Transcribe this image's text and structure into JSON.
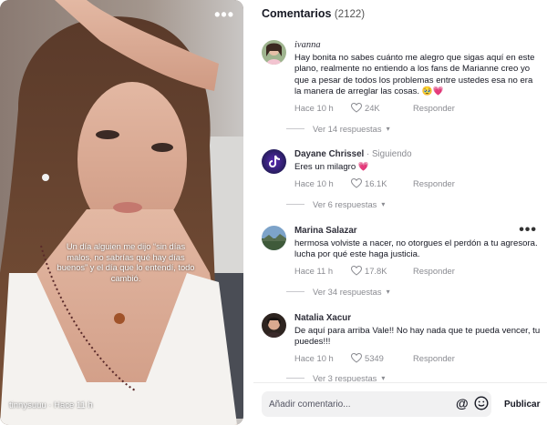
{
  "video": {
    "caption": "Un día alguien me dijo “sin días malos, no sabrías qué hay días buenos” y el día que lo entendí, todo cambió.",
    "author_time": "tinnysuuu · Hace 11 h",
    "more_icon": "more-horizontal-icon"
  },
  "comments_panel": {
    "title": "Comentarios",
    "count": "(2122)",
    "items": [
      {
        "username": "ivanna",
        "following": "",
        "text": "Hay bonita no sabes cuánto me alegro que sigas aquí en este plano, realmente no entiendo a los fans de Marianne creo yo que a pesar de todos los problemas entre ustedes esa no era la manera de arreglar las cosas. 🥹💗",
        "time": "Hace 10 h",
        "likes": "24K",
        "reply_label": "Responder",
        "view_replies": "Ver 14 respuestas"
      },
      {
        "username": "Dayane Chrissel",
        "following": " · Siguiendo",
        "text": "Eres un milagro 💗",
        "time": "Hace 10 h",
        "likes": "16.1K",
        "reply_label": "Responder",
        "view_replies": "Ver 6 respuestas"
      },
      {
        "username": "Marina Salazar",
        "following": "",
        "text": "hermosa volviste a nacer, no otorgues el perdón a tu agresora. lucha por qué este haga justicia.",
        "time": "Hace 11 h",
        "likes": "17.8K",
        "reply_label": "Responder",
        "view_replies": "Ver 34 respuestas"
      },
      {
        "username": "Natalia Xacur",
        "following": "",
        "text": "De aquí para arriba Vale!! No hay nada que te pueda vencer, tu puedes!!!",
        "time": "Hace 10 h",
        "likes": "5349",
        "reply_label": "Responder",
        "view_replies": "Ver 3 respuestas"
      }
    ]
  },
  "input": {
    "placeholder": "Añadir comentario...",
    "publish_label": "Publicar"
  },
  "colors": {
    "text": "#161823",
    "muted": "#8a8b91",
    "input_bg": "#f1f1f2"
  }
}
